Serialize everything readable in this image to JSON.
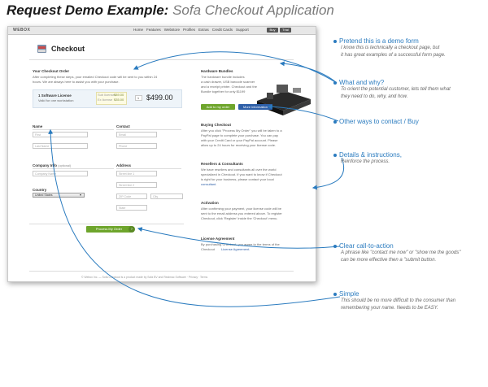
{
  "heading": {
    "bold": "Request Demo Example:",
    "light": "Sofa Checkout Application"
  },
  "app": {
    "brand": "WEBOX",
    "nav": [
      "Home",
      "Features",
      "Webstore",
      "Profiles",
      "Extras",
      "Credit Cards",
      "Support"
    ],
    "nav_buttons": [
      "Buy",
      "Trial"
    ],
    "title": "Checkout",
    "order_heading": "Your Checkout Order",
    "order_intro": [
      "After completing these steps, your emailed Checkout code will be sent to you within 24",
      "hours. We are always here to assist you with your purchase."
    ],
    "license": {
      "name": "1 Software License",
      "sub": "Valid for one workstation",
      "qty": "1",
      "discount_label_1": "Sub license",
      "discount_value_1": "$89.00",
      "discount_label_2": "Ex license",
      "discount_value_2": "$35.00",
      "price": "$499.00"
    },
    "labels": {
      "name": "Name",
      "contact": "Contact",
      "company": "Company Info",
      "company_optional": "(optional)",
      "address": "Address",
      "country": "Country"
    },
    "placeholders": {
      "first_name": "First",
      "last_name": "Last Name",
      "email": "Email",
      "phone": "Phone",
      "company_name": "Company Name",
      "street1": "Street line 1",
      "street2": "Street line 2",
      "zip": "ZIP Code",
      "city": "City",
      "state": "State"
    },
    "country_value": "United States",
    "cta": "Process My Order",
    "footer": "© Webox Inc. — Sofa Checkout is a product made by Sofa BV and Realmac Software · Privacy · Terms",
    "sidebar": {
      "bundle_title": "Hardware Bundles",
      "bundle_text": [
        "The hardware bundle includes",
        "a cash drawer, USB barcode scanner",
        "and a receipt printer. Checkout and the",
        "Bundle together for only $1199"
      ],
      "bundle_btn_primary": "Add to my order",
      "bundle_btn_secondary": "More information",
      "buying_title": "Buying Checkout",
      "buying_text": [
        "After you click \"Process My Order\" you will be taken to a",
        "PayPal page to complete your purchase. You can pay",
        "with your Credit Card or your PayPal account. Please",
        "allow up to 24 hours for receiving your license code."
      ],
      "resellers_title": "Resellers & Consultants",
      "resellers_text": [
        "We have resellers and consultants all over the world",
        "specialized in Checkout. If you want to know if Checkout",
        "is right for your business, please contact your local"
      ],
      "resellers_link": "consultant.",
      "activation_title": "Activation",
      "activation_text": [
        "After confirming your payment, your license code will be",
        "sent to the email address you entered above. To register",
        "Checkout, click 'Register' inside the 'Checkout' menu."
      ],
      "license_title": "License Agreement",
      "license_text": "By purchasing Checkout, you agree to the terms of the",
      "license_text2": "Checkout",
      "license_link": "License Agreement."
    }
  },
  "annotations": [
    {
      "title": "Pretend this is a demo form",
      "lines": [
        "I know this is technically a checkout page, but",
        "it has great examples of a successful form page."
      ]
    },
    {
      "title": "What and why?",
      "lines": [
        "To orient the potential customer, lets tell them what",
        "they need to do, why, and how."
      ]
    },
    {
      "title": "Other ways to contact / Buy",
      "lines": []
    },
    {
      "title": "Details & instructions,",
      "lines": [
        "Reinforce the process."
      ]
    },
    {
      "title": "Clear call-to-action",
      "lines": [
        "A phrase like \"contact me now\" or \"show me the goods\"",
        "can be more effective then a \"submit button."
      ]
    },
    {
      "title": "Simple",
      "lines": [
        "This should be no more difficult to the consumer than",
        "remembering your name. Needs to be EASY."
      ]
    }
  ],
  "colors": {
    "annotation": "#2a7bbf",
    "cta_green": "#6ea52c",
    "button_blue": "#2e5fa8"
  }
}
